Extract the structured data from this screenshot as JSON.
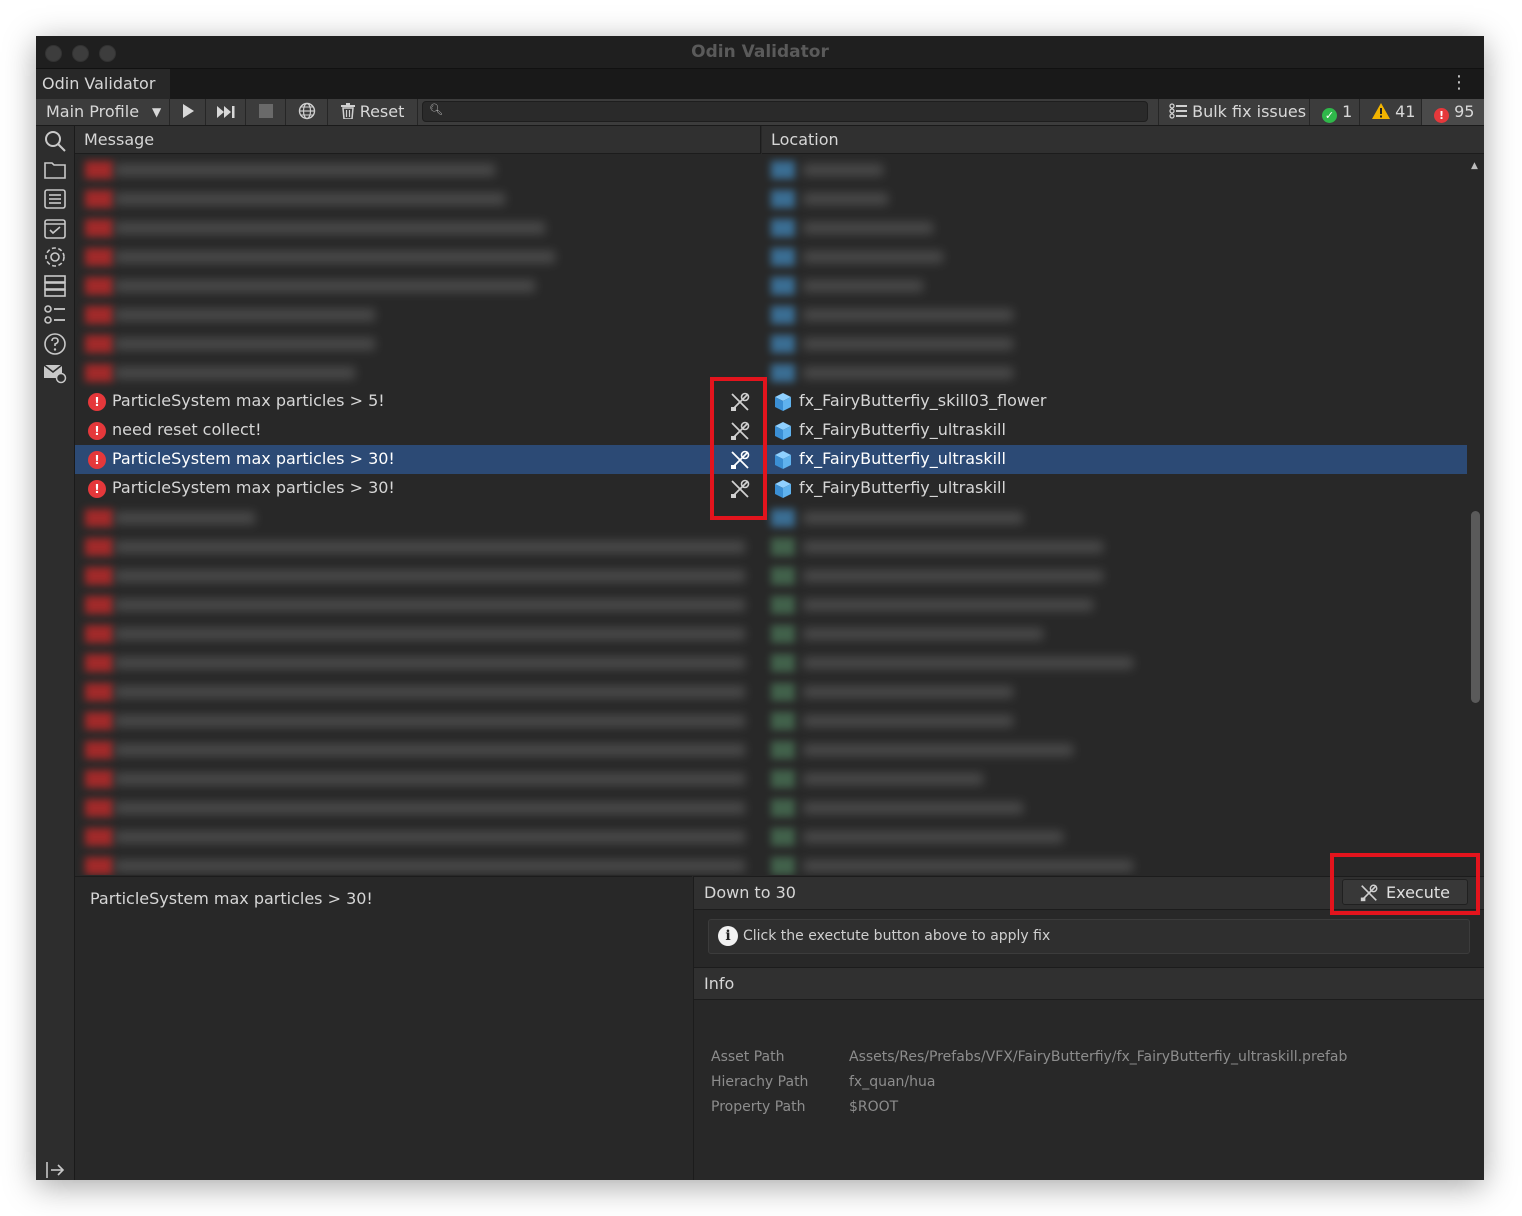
{
  "window": {
    "title": "Odin Validator"
  },
  "tab": {
    "label": "Odin Validator",
    "menu_icon": "vertical-ellipsis-icon"
  },
  "toolbar": {
    "profile": "Main Profile",
    "reset": "Reset",
    "search_placeholder": "",
    "bulk_fix": "Bulk fix issues",
    "valid_count": "1",
    "warning_count": "41",
    "error_count": "95"
  },
  "columns": {
    "message": "Message",
    "location": "Location"
  },
  "rows": [
    {
      "message": "ParticleSystem max particles > 5!",
      "location": "fx_FairyButterfiy_skill03_flower"
    },
    {
      "message": "need reset collect!",
      "location": "fx_FairyButterfiy_ultraskill"
    },
    {
      "message": "ParticleSystem max particles > 30!",
      "location": "fx_FairyButterfiy_ultraskill"
    },
    {
      "message": "ParticleSystem max particles > 30!",
      "location": "fx_FairyButterfiy_ultraskill"
    }
  ],
  "detail": {
    "selected_message": "ParticleSystem max particles > 30!",
    "fix_title": "Down to 30",
    "execute": "Execute",
    "hint": "Click the exectute button above to apply fix",
    "info_title": "Info",
    "info": [
      {
        "key": "Asset Path",
        "value": "Assets/Res/Prefabs/VFX/FairyButterfiy/fx_FairyButterfiy_ultraskill.prefab"
      },
      {
        "key": "Hierachy Path",
        "value": "fx_quan/hua"
      },
      {
        "key": "Property Path",
        "value": "$ROOT"
      }
    ]
  },
  "colors": {
    "error": "#e5383b",
    "warning": "#f2b400",
    "valid": "#2fb84a",
    "selection": "#2c4a75",
    "highlight": "#e3141d"
  }
}
